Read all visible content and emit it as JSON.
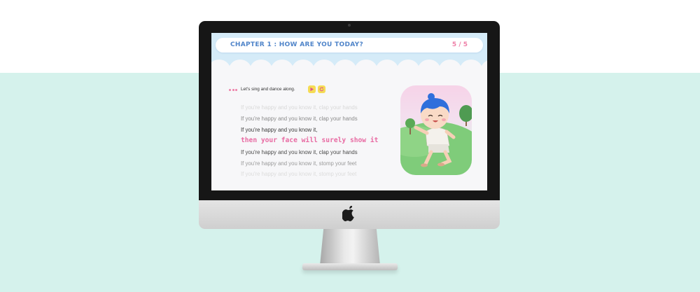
{
  "header": {
    "chapter_title": "CHAPTER 1 : HOW ARE YOU TODAY?",
    "page_indicator": "5 / 5"
  },
  "instruction": {
    "text": "Let's sing and dance along.",
    "play_icon": "play-icon",
    "replay_icon": "replay-icon"
  },
  "lyrics": [
    {
      "text": "If you're happy and you know it, clap your hands",
      "state": "faded"
    },
    {
      "text": "If you're happy and you know it, clap your hands",
      "state": "past"
    },
    {
      "text": "If you're happy and you know it,",
      "state": "previous"
    },
    {
      "text": "then your face will surely show it",
      "state": "current"
    },
    {
      "text": "If you're happy and you know it, clap your hands",
      "state": "upcoming"
    },
    {
      "text": "If you're happy and you know it, stomp your feet",
      "state": "later"
    },
    {
      "text": "If you're happy and you know it, stomp your feet",
      "state": "faded"
    }
  ],
  "illustration": {
    "subject": "child-dancing-illustration"
  },
  "colors": {
    "accent_pink": "#e86aa2",
    "title_blue": "#4f84c9",
    "mint_background": "#d5f2ec",
    "sky": "#d5ebf8"
  }
}
